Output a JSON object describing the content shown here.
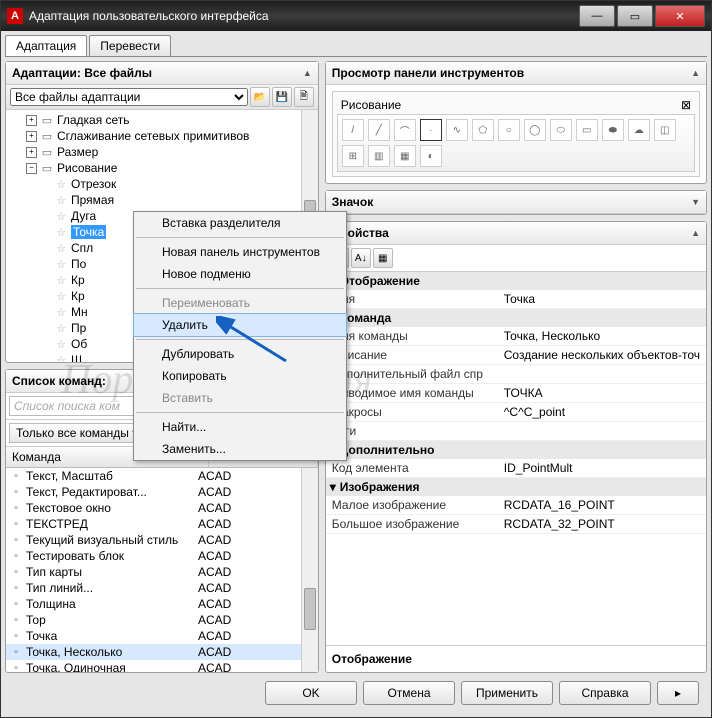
{
  "window": {
    "title": "Адаптация пользовательского интерфейса"
  },
  "tabs": {
    "adapt": "Адаптация",
    "translate": "Перевести"
  },
  "adaptations": {
    "title": "Адаптации: Все файлы",
    "dropdown": "Все файлы адаптации"
  },
  "tree": {
    "n1": "Гладкая сеть",
    "n2": "Сглаживание сетевых примитивов",
    "n3": "Размер",
    "n4": "Рисование",
    "c1": "Отрезок",
    "c2": "Прямая",
    "c3": "Дуга",
    "c4": "Точка",
    "c5": "Спл",
    "c6": "По",
    "c7": "Кр",
    "c8": "Кр",
    "c9": "Мн",
    "c10": "Пр",
    "c11": "Об",
    "c12": "Ш"
  },
  "context": {
    "m1": "Вставка разделителя",
    "m2": "Новая панель инструментов",
    "m3": "Новое подменю",
    "m4": "Переименовать",
    "m5": "Удалить",
    "m6": "Дублировать",
    "m7": "Копировать",
    "m8": "Вставить",
    "m9": "Найти...",
    "m10": "Заменить..."
  },
  "commands": {
    "title": "Список команд:",
    "placeholder": "Список поиска ком",
    "filter": "Только все команды",
    "col1": "Команда",
    "col2": "Источник",
    "rows": [
      {
        "name": "Текст, Масштаб",
        "src": "ACAD"
      },
      {
        "name": "Текст, Редактироват...",
        "src": "ACAD"
      },
      {
        "name": "Текстовое окно",
        "src": "ACAD"
      },
      {
        "name": "ТЕКСТРЕД",
        "src": "ACAD"
      },
      {
        "name": "Текущий визуальный стиль",
        "src": "ACAD"
      },
      {
        "name": "Тестировать блок",
        "src": "ACAD"
      },
      {
        "name": "Тип карты",
        "src": "ACAD"
      },
      {
        "name": "Тип линий...",
        "src": "ACAD"
      },
      {
        "name": "Толщина",
        "src": "ACAD"
      },
      {
        "name": "Тор",
        "src": "ACAD"
      },
      {
        "name": "Точка",
        "src": "ACAD"
      },
      {
        "name": "Точка, Несколько",
        "src": "ACAD"
      },
      {
        "name": "Точка, Одиночная",
        "src": "ACAD"
      }
    ],
    "highlight_index": 11
  },
  "preview": {
    "title": "Просмотр панели инструментов",
    "group": "Рисование"
  },
  "icon_section": {
    "title": "Значок"
  },
  "props": {
    "title": "Свойства",
    "cat1": "Отображение",
    "r1k": "Имя",
    "r1v": "Точка",
    "cat2": "Команда",
    "r2k": "Имя команды",
    "r2v": "Точка, Несколько",
    "r3k": "Описание",
    "r3v": "Создание нескольких объектов-точ",
    "r4k": "Дополнительный файл спр",
    "r4v": "",
    "r5k": "Выводимое имя команды",
    "r5v": "ТОЧКА",
    "r6k": "Макросы",
    "r6v": "^C^C_point",
    "r7k": "Теги",
    "r7v": "",
    "cat3": "Дополнительно",
    "r8k": "Код элемента",
    "r8v": "ID_PointMult",
    "cat4": "Изображения",
    "r9k": "Малое изображение",
    "r9v": "RCDATA_16_POINT",
    "r10k": "Большое изображение",
    "r10v": "RCDATA_32_POINT",
    "footer": "Отображение"
  },
  "buttons": {
    "ok": "OK",
    "cancel": "Отмена",
    "apply": "Применить",
    "help": "Справка"
  },
  "watermark": "Портал черчения"
}
